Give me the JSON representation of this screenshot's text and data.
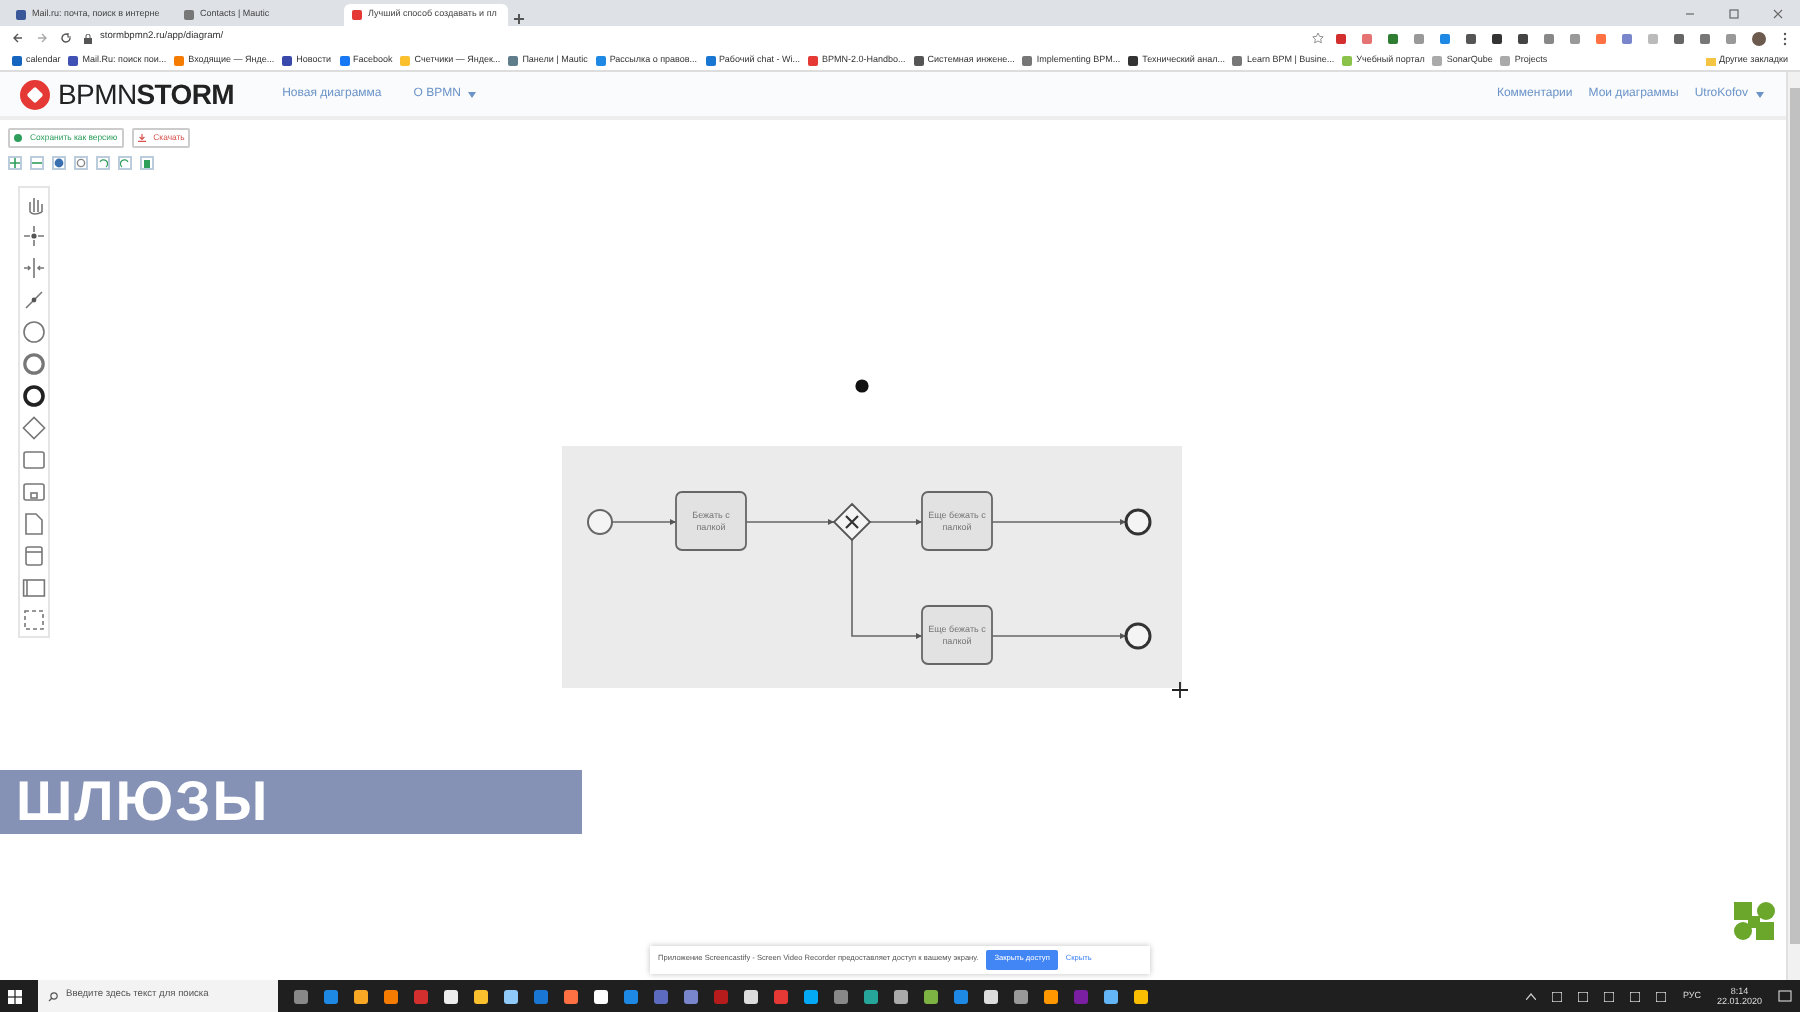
{
  "browser": {
    "tabs": [
      {
        "title": "Mail.ru: почта, поиск в интерне",
        "selected": false
      },
      {
        "title": "Contacts | Mautic",
        "selected": false
      },
      {
        "title": "Лучший способ создавать и пл",
        "selected": true
      }
    ],
    "address": "stormbpmn2.ru/app/diagram/",
    "bookmarks": [
      "calendar",
      "Mail.Ru: поиск пои...",
      "Входящие — Янде...",
      "Новости",
      "Facebook",
      "Счетчики — Яндек...",
      "Панели | Mautic",
      "Рассылка о правов...",
      "Рабочий chat - Wi...",
      "BPMN-2.0-Handbo...",
      "Системная инжене...",
      "Implementing BPM...",
      "Технический анал...",
      "Learn BPM | Busine...",
      "Учебный портал",
      "SonarQube",
      "Projects"
    ],
    "other_bookmarks": "Другие закладки"
  },
  "app": {
    "logo": "BPMN**STORM**",
    "nav_left": [
      {
        "label": "Новая диаграмма",
        "kind": "link"
      },
      {
        "label": "О BPMN",
        "kind": "dropdown"
      }
    ],
    "nav_right": [
      {
        "label": "Комментарии",
        "kind": "link"
      },
      {
        "label": "Мои диаграммы",
        "kind": "link"
      },
      {
        "label": "UtroKofov",
        "kind": "dropdown"
      }
    ],
    "actions": [
      {
        "label": "Сохранить как версию",
        "kind": "save"
      },
      {
        "label": "Скачать",
        "kind": "download"
      }
    ]
  },
  "diagram": {
    "tasks": [
      "Бежать с палкой",
      "Еще бежать с палкой",
      "Еще бежать с палкой"
    ]
  },
  "caption": "ШЛЮЗЫ",
  "notice": {
    "text": "Приложение Screencastify - Screen Video Recorder предоставляет доступ к вашему экрану.",
    "button": "Закрыть доступ",
    "link": "Скрыть"
  },
  "taskbar": {
    "search_placeholder": "Введите здесь текст для поиска",
    "language": "РУС",
    "time": "8:14",
    "date": "22.01.2020"
  }
}
